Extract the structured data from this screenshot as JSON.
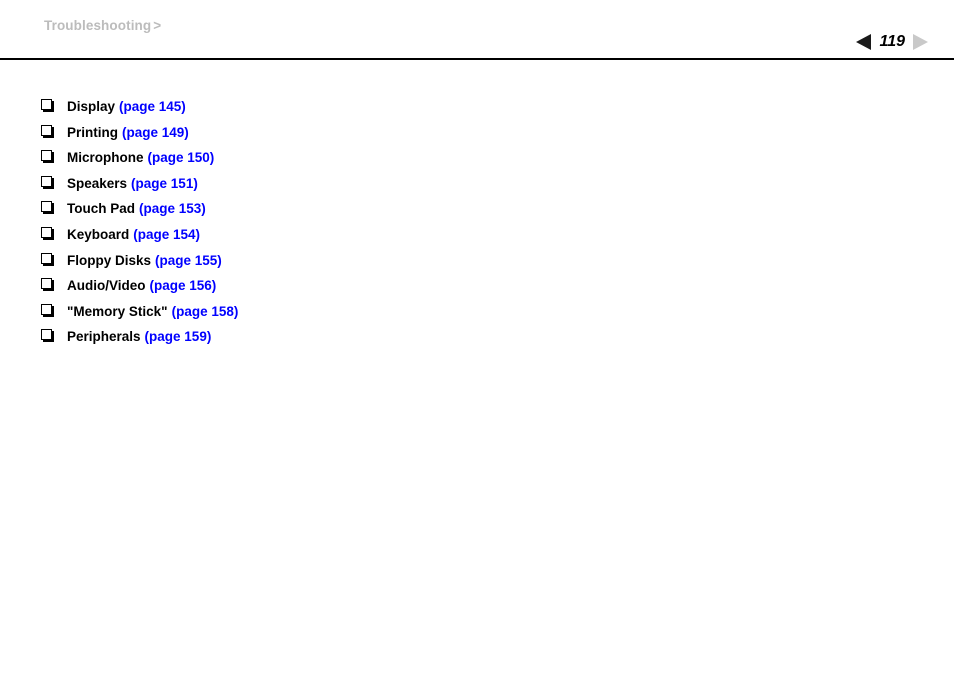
{
  "header": {
    "breadcrumb_text": "Troubleshooting",
    "breadcrumb_separator": ">",
    "page_number": "119",
    "prev_arrow_icon": "triangle-left-icon",
    "next_arrow_icon": "triangle-right-icon",
    "prev_arrow_color": "#1a1a1a",
    "next_arrow_color": "#c9c9c9",
    "breadcrumb_color": "#bcbcbc"
  },
  "colors": {
    "link": "#0000ff",
    "text": "#000000",
    "rule": "#000000",
    "background": "#ffffff"
  },
  "list": {
    "bullet_icon": "hollow-square-bullet-icon",
    "items": [
      {
        "label": "Display",
        "link": "(page 145)"
      },
      {
        "label": "Printing",
        "link": "(page 149)"
      },
      {
        "label": "Microphone",
        "link": "(page 150)"
      },
      {
        "label": "Speakers",
        "link": "(page 151)"
      },
      {
        "label": "Touch Pad",
        "link": "(page 153)"
      },
      {
        "label": "Keyboard",
        "link": "(page 154)"
      },
      {
        "label": "Floppy Disks",
        "link": "(page 155)"
      },
      {
        "label": "Audio/Video",
        "link": "(page 156)"
      },
      {
        "label": "\"Memory Stick\"",
        "link": "(page 158)"
      },
      {
        "label": "Peripherals",
        "link": "(page 159)"
      }
    ]
  }
}
